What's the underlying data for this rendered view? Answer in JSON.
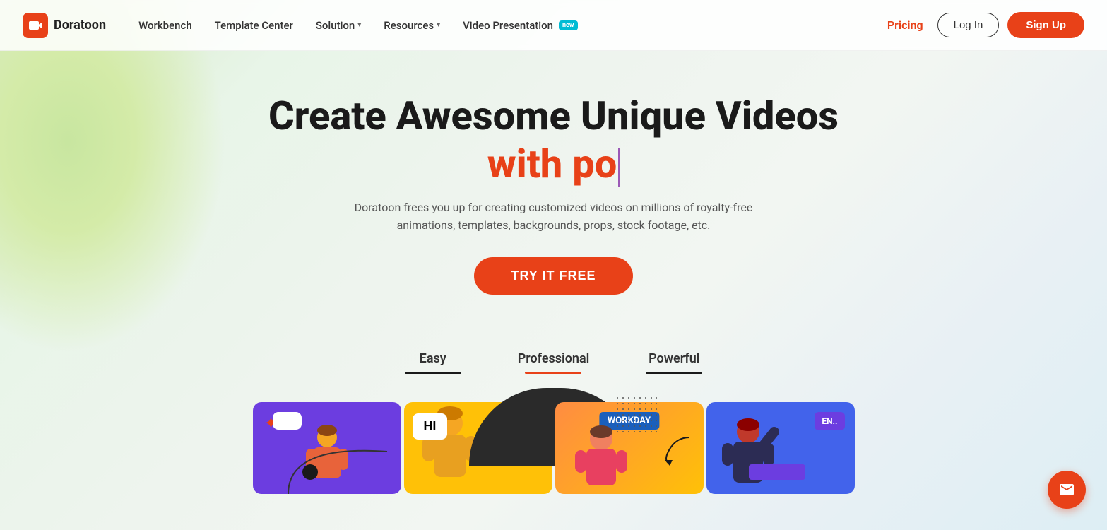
{
  "logo": {
    "icon": "▶",
    "text": "Doratoon"
  },
  "nav": {
    "links": [
      {
        "label": "Workbench",
        "hasDropdown": false
      },
      {
        "label": "Template Center",
        "hasDropdown": false
      },
      {
        "label": "Solution",
        "hasDropdown": true
      },
      {
        "label": "Resources",
        "hasDropdown": true
      },
      {
        "label": "Video Presentation",
        "hasDropdown": false,
        "badge": "new"
      }
    ],
    "pricing": "Pricing",
    "login": "Log In",
    "signup": "Sign Up"
  },
  "hero": {
    "title": "Create Awesome Unique Videos",
    "subtitle_text": "with po",
    "description": "Doratoon frees you up for creating customized videos on millions of royalty-free animations, templates, backgrounds, props, stock footage, etc.",
    "cta": "TRY IT FREE"
  },
  "tabs": [
    {
      "label": "Easy",
      "active": false,
      "underline": "dark"
    },
    {
      "label": "Professional",
      "active": true,
      "underline": "orange"
    },
    {
      "label": "Powerful",
      "active": false,
      "underline": "dark2"
    }
  ],
  "cards": [
    {
      "id": "card-purple",
      "bg": "#6c3de0"
    },
    {
      "id": "card-yellow",
      "bg": "#ffc107"
    },
    {
      "id": "card-orange",
      "bg": "#ff8c42"
    },
    {
      "id": "card-blue",
      "bg": "#4263eb"
    }
  ],
  "bubbles": {
    "hi": "HI",
    "workday": "WORKDAY",
    "en": "EN.."
  },
  "colors": {
    "brand_orange": "#e84118",
    "brand_purple": "#6c3de0",
    "nav_bg": "rgba(255,255,255,0.9)"
  },
  "chat_icon": "✉"
}
